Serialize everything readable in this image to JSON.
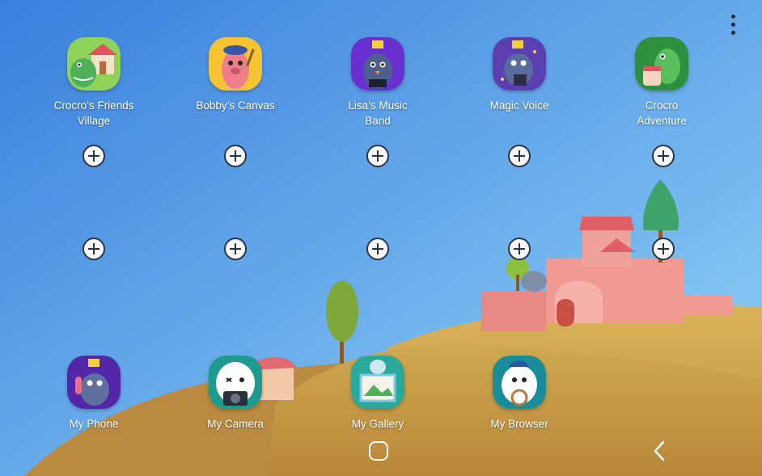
{
  "colors": {
    "sky_top": "#3f86dd",
    "sky_bottom": "#8fd2f5",
    "hill": "#c9a44c",
    "castle": "#e88a88",
    "tree": "#3ca36a"
  },
  "top_menu": {
    "icon": "more-vert-icon"
  },
  "apps_row": [
    {
      "id": "crocro-friends-village",
      "label": "Crocro’s Friends Village",
      "label_lines": [
        "Crocro’s Friends",
        "Village"
      ],
      "icon": "crocro-friends-village-icon"
    },
    {
      "id": "bobbys-canvas",
      "label": "Bobby’s Canvas",
      "label_lines": [
        "Bobby’s Canvas"
      ],
      "icon": "bobbys-canvas-icon"
    },
    {
      "id": "lisas-music-band",
      "label": "Lisa’s Music Band",
      "label_lines": [
        "Lisa’s Music",
        "Band"
      ],
      "icon": "lisas-music-band-icon"
    },
    {
      "id": "magic-voice",
      "label": "Magic Voice",
      "label_lines": [
        "Magic Voice"
      ],
      "icon": "magic-voice-icon"
    },
    {
      "id": "crocro-adventure",
      "label": "Crocro Adventure",
      "label_lines": [
        "Crocro",
        "Adventure"
      ],
      "icon": "crocro-adventure-icon"
    }
  ],
  "add_slots": {
    "rows": 2,
    "cols": 5,
    "icon": "add-circle-icon"
  },
  "dock_apps": [
    {
      "id": "my-phone",
      "label": "My Phone",
      "icon": "phone-icon"
    },
    {
      "id": "my-camera",
      "label": "My Camera",
      "icon": "camera-icon"
    },
    {
      "id": "my-gallery",
      "label": "My Gallery",
      "icon": "gallery-icon"
    },
    {
      "id": "my-browser",
      "label": "My Browser",
      "icon": "browser-icon"
    }
  ],
  "navbar": {
    "home_icon": "home-icon",
    "back_icon": "back-icon"
  }
}
